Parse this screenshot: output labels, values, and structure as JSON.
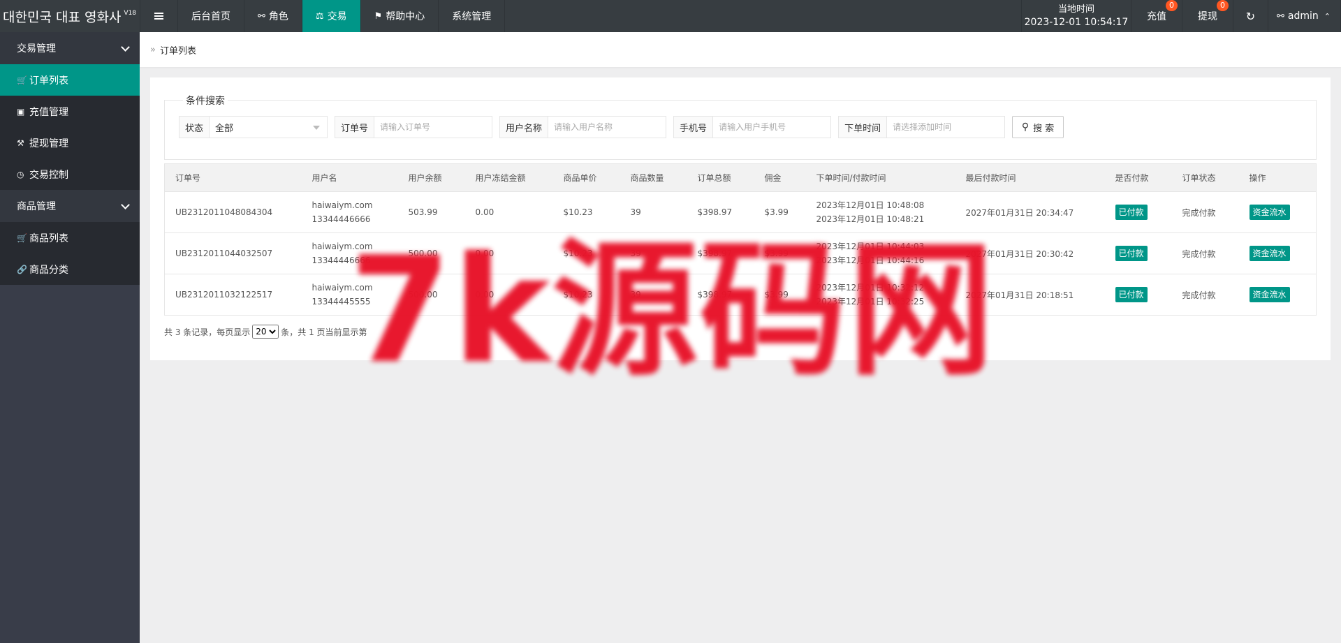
{
  "header": {
    "brand": "대한민국 대표 영화사",
    "brand_version": "V18",
    "nav": [
      {
        "label": "后台首页",
        "icon": ""
      },
      {
        "label": "角色",
        "icon": "user-icon"
      },
      {
        "label": "交易",
        "icon": "balance-icon",
        "active": true
      },
      {
        "label": "帮助中心",
        "icon": "flag-icon"
      },
      {
        "label": "系统管理",
        "icon": ""
      }
    ],
    "clock_label": "当地时间",
    "clock_value": "2023-12-01 10:54:17",
    "recharge_label": "充值",
    "recharge_badge": "0",
    "withdraw_label": "提现",
    "withdraw_badge": "0",
    "user_name": "admin"
  },
  "sidebar": {
    "groups": [
      {
        "label": "交易管理",
        "items": [
          {
            "label": "订单列表",
            "icon": "cart-icon",
            "active": true
          },
          {
            "label": "充值管理",
            "icon": "comment-icon"
          },
          {
            "label": "提现管理",
            "icon": "hammer-icon"
          },
          {
            "label": "交易控制",
            "icon": "gauge-icon"
          }
        ]
      },
      {
        "label": "商品管理",
        "items": [
          {
            "label": "商品列表",
            "icon": "cart-icon"
          },
          {
            "label": "商品分类",
            "icon": "link-icon"
          }
        ]
      }
    ]
  },
  "breadcrumb": "订单列表",
  "search": {
    "legend": "条件搜索",
    "status_label": "状态",
    "status_value": "全部",
    "order_label": "订单号",
    "order_placeholder": "请输入订单号",
    "username_label": "用户名称",
    "username_placeholder": "请输入用户名称",
    "phone_label": "手机号",
    "phone_placeholder": "请输入用户手机号",
    "time_label": "下单时间",
    "time_placeholder": "请选择添加时间",
    "button_label": "搜 索"
  },
  "table": {
    "headers": [
      "订单号",
      "用户名",
      "用户余额",
      "用户冻结金额",
      "商品单价",
      "商品数量",
      "订单总额",
      "佣金",
      "下单时间/付款时间",
      "最后付款时间",
      "是否付款",
      "订单状态",
      "操作"
    ],
    "rows": [
      {
        "order_no": "UB2312011048084304",
        "user": "haiwaiym.com",
        "phone": "13344446666",
        "balance": "503.99",
        "frozen": "0.00",
        "price": "$10.23",
        "qty": "39",
        "total": "$398.97",
        "commission": "$3.99",
        "order_time": "2023年12月01日 10:48:08",
        "pay_time": "2023年12月01日 10:48:21",
        "last_pay": "2027年01月31日 20:34:47",
        "paid": "已付款",
        "status": "完成付款",
        "action": "资金流水"
      },
      {
        "order_no": "UB2312011044032507",
        "user": "haiwaiym.com",
        "phone": "13344446666",
        "balance": "500.00",
        "frozen": "0.00",
        "price": "$10.23",
        "qty": "39",
        "total": "$398.97",
        "commission": "$3.99",
        "order_time": "2023年12月01日 10:44:03",
        "pay_time": "2023年12月01日 10:44:16",
        "last_pay": "2027年01月31日 20:30:42",
        "paid": "已付款",
        "status": "完成付款",
        "action": "资金流水"
      },
      {
        "order_no": "UB2312011032122517",
        "user": "haiwaiym.com",
        "phone": "13344445555",
        "balance": "500.00",
        "frozen": "0.00",
        "price": "$10.23",
        "qty": "39",
        "total": "$398.97",
        "commission": "$3.99",
        "order_time": "2023年12月01日 10:32:12",
        "pay_time": "2023年12月01日 10:32:25",
        "last_pay": "2027年01月31日 20:18:51",
        "paid": "已付款",
        "status": "完成付款",
        "action": "资金流水"
      }
    ]
  },
  "pager": {
    "prefix": "共 3 条记录，每页显示",
    "page_size": "20",
    "suffix": "条，共 1 页当前显示第"
  },
  "watermark": "7k源码网",
  "colors": {
    "accent": "#009688",
    "header_bg": "#373d41",
    "sidebar_bg": "#393d49",
    "badge": "#ff5722",
    "watermark": "#e8142a"
  }
}
